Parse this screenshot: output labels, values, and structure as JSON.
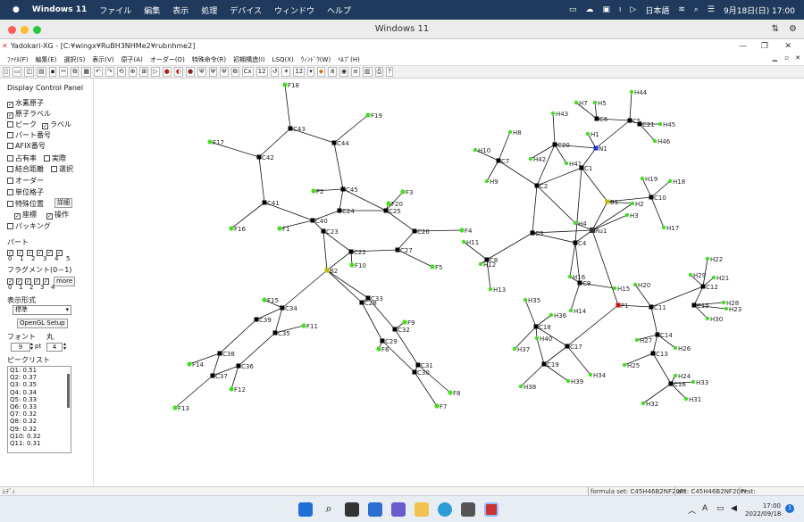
{
  "mac_menu": {
    "app": "Windows 11",
    "items": [
      "ファイル",
      "編集",
      "表示",
      "処理",
      "デバイス",
      "ウィンドウ",
      "ヘルプ"
    ],
    "ime": "日本語",
    "date": "9月18日(日) 17:00"
  },
  "vm_title": "Windows 11",
  "window": {
    "title": "Yadokari-XG - [C:¥wingx¥RuBH3NHMe2¥rubnhme2]"
  },
  "menu": [
    "ﾌｧｲﾙ(F)",
    "編集(E)",
    "選択(S)",
    "表示(V)",
    "原子(A)",
    "オーダー(O)",
    "特殊命令(R)",
    "初期構造(I)",
    "LSQ(X)",
    "ｳｨﾝﾄﾞｳ(W)",
    "ﾍﾙﾌﾟ(H)"
  ],
  "toolbar": {
    "cx": "Cx",
    "num": "12",
    "font_size": "12"
  },
  "panel": {
    "title": "Display Control Panel",
    "checks": [
      {
        "label": "水素原子",
        "checked": true
      },
      {
        "label": "原子ラベル",
        "checked": true
      },
      {
        "label": "ピーク",
        "checked": false
      },
      {
        "label": "ラベル",
        "checked": true
      },
      {
        "label": "パート番号",
        "checked": false
      },
      {
        "label": "AFIX番号",
        "checked": false
      },
      {
        "label": "占有率",
        "checked": false
      },
      {
        "label": "実際",
        "checked": false
      },
      {
        "label": "結合距離",
        "checked": false
      },
      {
        "label": "選択",
        "checked": false
      },
      {
        "label": "オーダー",
        "checked": false
      },
      {
        "label": "単位格子",
        "checked": false
      },
      {
        "label": "特殊位置",
        "checked": false
      },
      {
        "label": "座標",
        "checked": true
      },
      {
        "label": "操作",
        "checked": true
      },
      {
        "label": "パッキング",
        "checked": false
      }
    ],
    "detail_btn": "詳細",
    "part_label": "パート",
    "part_nums": [
      "0",
      "1",
      "2",
      "3",
      "4",
      "5"
    ],
    "frag_label": "フラグメント(0－1)",
    "frag_nums": [
      "0",
      "1",
      "2",
      "3",
      "4"
    ],
    "more_btn": "more",
    "display_label": "表示形式",
    "display_value": "標準",
    "opengl_btn": "OpenGL Setup",
    "font_label": "フォント",
    "font_value": "9",
    "font_unit": "pt",
    "circle_label": "丸",
    "circle_value": "4",
    "peak_label": "ピークリスト",
    "peaks": [
      "Q1:  0.51",
      "Q2:  0.37",
      "Q3:  0.35",
      "Q4:  0.34",
      "Q5:  0.33",
      "Q6:  0.33",
      "Q7:  0.32",
      "Q8:  0.32",
      "Q9:  0.32",
      "Q10:  0.32",
      "Q11:  0.31"
    ]
  },
  "status": {
    "left": "ﾚﾃﾞｨ",
    "formula": "formula set: C45H46B2NF20PI",
    "act": "act: C45H46B2NF20PI",
    "rest": "rest:"
  },
  "taskbar": {
    "time": "17:00",
    "date": "2022/09/18",
    "notif": "1"
  },
  "colors": {
    "h": "#44dd22",
    "f": "#44dd22",
    "c": "#000000",
    "n": "#2233cc",
    "p": "#cc1111",
    "b": "#bbbb00",
    "ru": "#333333"
  },
  "molecule": {
    "atoms": [
      [
        "F18",
        "f",
        212,
        7
      ],
      [
        "C43",
        "c",
        218,
        56
      ],
      [
        "F19",
        "f",
        305,
        41
      ],
      [
        "C44",
        "c",
        267,
        72
      ],
      [
        "F17",
        "f",
        128,
        71
      ],
      [
        "C42",
        "c",
        183,
        88
      ],
      [
        "F2",
        "f",
        244,
        126
      ],
      [
        "C45",
        "c",
        277,
        124
      ],
      [
        "F3",
        "f",
        344,
        127
      ],
      [
        "F20",
        "f",
        328,
        140
      ],
      [
        "C41",
        "c",
        189,
        139
      ],
      [
        "C24",
        "c",
        273,
        148
      ],
      [
        "C25",
        "c",
        325,
        148
      ],
      [
        "C40",
        "c",
        243,
        159
      ],
      [
        "F16",
        "f",
        152,
        168
      ],
      [
        "F1",
        "f",
        206,
        168
      ],
      [
        "C23",
        "c",
        255,
        171
      ],
      [
        "C26",
        "c",
        357,
        171
      ],
      [
        "F4",
        "f",
        410,
        170
      ],
      [
        "C22",
        "c",
        286,
        194
      ],
      [
        "C27",
        "c",
        338,
        192
      ],
      [
        "F10",
        "f",
        287,
        209
      ],
      [
        "F5",
        "f",
        377,
        211
      ],
      [
        "B2",
        "b",
        259,
        215
      ],
      [
        "C33",
        "c",
        305,
        246
      ],
      [
        "C28",
        "c",
        298,
        251
      ],
      [
        "F15",
        "f",
        189,
        248
      ],
      [
        "C34",
        "c",
        209,
        257
      ],
      [
        "C39",
        "c",
        180,
        270
      ],
      [
        "F9",
        "f",
        346,
        273
      ],
      [
        "F11",
        "f",
        233,
        277
      ],
      [
        "C35",
        "c",
        201,
        285
      ],
      [
        "C32",
        "c",
        335,
        281
      ],
      [
        "C29",
        "c",
        321,
        294
      ],
      [
        "F6",
        "f",
        317,
        303
      ],
      [
        "C38",
        "c",
        139,
        308
      ],
      [
        "F14",
        "f",
        105,
        320
      ],
      [
        "C36",
        "c",
        160,
        322
      ],
      [
        "C31",
        "c",
        361,
        321
      ],
      [
        "C30",
        "c",
        357,
        329
      ],
      [
        "C37",
        "c",
        131,
        333
      ],
      [
        "F12",
        "f",
        152,
        348
      ],
      [
        "F8",
        "f",
        397,
        352
      ],
      [
        "F13",
        "f",
        89,
        369
      ],
      [
        "F7",
        "f",
        382,
        367
      ],
      [
        "H7",
        "h",
        538,
        27
      ],
      [
        "H5",
        "h",
        559,
        27
      ],
      [
        "H44",
        "h",
        600,
        15
      ],
      [
        "H43",
        "h",
        512,
        39
      ],
      [
        "C6",
        "c",
        561,
        45
      ],
      [
        "C5",
        "c",
        598,
        47
      ],
      [
        "C21",
        "c",
        609,
        51
      ],
      [
        "H45",
        "h",
        632,
        51
      ],
      [
        "H8",
        "h",
        464,
        60
      ],
      [
        "H1",
        "h",
        551,
        62
      ],
      [
        "C20",
        "c",
        514,
        74
      ],
      [
        "N1",
        "n",
        560,
        78
      ],
      [
        "H46",
        "h",
        626,
        70
      ],
      [
        "H10",
        "h",
        425,
        80
      ],
      [
        "C7",
        "c",
        451,
        92
      ],
      [
        "H42",
        "h",
        487,
        90
      ],
      [
        "H41",
        "h",
        527,
        95
      ],
      [
        "C1",
        "c",
        544,
        100
      ],
      [
        "H9",
        "h",
        438,
        115
      ],
      [
        "C2",
        "c",
        494,
        120
      ],
      [
        "H19",
        "h",
        612,
        112
      ],
      [
        "H18",
        "h",
        643,
        115
      ],
      [
        "C10",
        "c",
        622,
        133
      ],
      [
        "B1",
        "b",
        573,
        138
      ],
      [
        "H2",
        "h",
        601,
        140
      ],
      [
        "H3",
        "h",
        595,
        153
      ],
      [
        "H4",
        "h",
        537,
        162
      ],
      [
        "Ru1",
        "ru",
        556,
        170
      ],
      [
        "H17",
        "h",
        636,
        167
      ],
      [
        "C3",
        "c",
        489,
        173
      ],
      [
        "C4",
        "c",
        537,
        184
      ],
      [
        "H11",
        "h",
        412,
        183
      ],
      [
        "C8",
        "c",
        438,
        203
      ],
      [
        "H12",
        "h",
        431,
        208
      ],
      [
        "H22",
        "h",
        685,
        202
      ],
      [
        "H29",
        "h",
        666,
        220
      ],
      [
        "H21",
        "h",
        692,
        223
      ],
      [
        "H16",
        "h",
        531,
        222
      ],
      [
        "C9",
        "c",
        542,
        229
      ],
      [
        "H13",
        "h",
        442,
        236
      ],
      [
        "H15",
        "h",
        581,
        235
      ],
      [
        "H20",
        "h",
        604,
        231
      ],
      [
        "C12",
        "c",
        680,
        233
      ],
      [
        "H28",
        "h",
        703,
        251
      ],
      [
        "H35",
        "h",
        481,
        248
      ],
      [
        "P1",
        "p",
        585,
        254
      ],
      [
        "C11",
        "c",
        622,
        256
      ],
      [
        "C15",
        "c",
        670,
        254
      ],
      [
        "H23",
        "h",
        706,
        258
      ],
      [
        "H14",
        "h",
        532,
        260
      ],
      [
        "H36",
        "h",
        510,
        265
      ],
      [
        "C18",
        "c",
        493,
        278
      ],
      [
        "H30",
        "h",
        685,
        269
      ],
      [
        "H40",
        "h",
        494,
        291
      ],
      [
        "C14",
        "c",
        629,
        287
      ],
      [
        "H27",
        "h",
        606,
        293
      ],
      [
        "C17",
        "c",
        528,
        300
      ],
      [
        "H37",
        "h",
        469,
        303
      ],
      [
        "H26",
        "h",
        649,
        302
      ],
      [
        "C13",
        "c",
        624,
        308
      ],
      [
        "C19",
        "c",
        502,
        320
      ],
      [
        "H25",
        "h",
        592,
        321
      ],
      [
        "H34",
        "h",
        554,
        332
      ],
      [
        "H24",
        "h",
        649,
        333
      ],
      [
        "C16",
        "c",
        644,
        342
      ],
      [
        "H33",
        "h",
        669,
        340
      ],
      [
        "H39",
        "h",
        529,
        339
      ],
      [
        "H38",
        "h",
        476,
        345
      ],
      [
        "H31",
        "h",
        661,
        359
      ],
      [
        "H32",
        "h",
        613,
        364
      ]
    ],
    "bonds": [
      [
        "F18",
        "C43"
      ],
      [
        "C43",
        "C42"
      ],
      [
        "C43",
        "C44"
      ],
      [
        "C44",
        "F19"
      ],
      [
        "C42",
        "F17"
      ],
      [
        "C42",
        "C41"
      ],
      [
        "C44",
        "C45"
      ],
      [
        "C45",
        "F2"
      ],
      [
        "C45",
        "C24"
      ],
      [
        "C45",
        "C25"
      ],
      [
        "C41",
        "F16"
      ],
      [
        "C41",
        "C40"
      ],
      [
        "C40",
        "C24"
      ],
      [
        "C24",
        "C25"
      ],
      [
        "C25",
        "F3"
      ],
      [
        "C25",
        "F20"
      ],
      [
        "C25",
        "C26"
      ],
      [
        "C40",
        "F1"
      ],
      [
        "C40",
        "C23"
      ],
      [
        "C23",
        "C22"
      ],
      [
        "C23",
        "B2"
      ],
      [
        "C26",
        "F4"
      ],
      [
        "C26",
        "C27"
      ],
      [
        "C22",
        "C27"
      ],
      [
        "C27",
        "F5"
      ],
      [
        "C22",
        "F10"
      ],
      [
        "C22",
        "B2"
      ],
      [
        "B2",
        "C33"
      ],
      [
        "B2",
        "C28"
      ],
      [
        "B2",
        "C34"
      ],
      [
        "C28",
        "C33"
      ],
      [
        "C28",
        "C29"
      ],
      [
        "C33",
        "C32"
      ],
      [
        "C32",
        "F9"
      ],
      [
        "C32",
        "C31"
      ],
      [
        "C29",
        "F6"
      ],
      [
        "C29",
        "C30"
      ],
      [
        "C31",
        "C30"
      ],
      [
        "C31",
        "F8"
      ],
      [
        "C30",
        "F7"
      ],
      [
        "C34",
        "F15"
      ],
      [
        "C34",
        "C35"
      ],
      [
        "C34",
        "C39"
      ],
      [
        "C39",
        "C38"
      ],
      [
        "C35",
        "F11"
      ],
      [
        "C35",
        "C36"
      ],
      [
        "C38",
        "F14"
      ],
      [
        "C38",
        "C37"
      ],
      [
        "C36",
        "C37"
      ],
      [
        "C36",
        "F12"
      ],
      [
        "C37",
        "F13"
      ],
      [
        "C6",
        "H7"
      ],
      [
        "C6",
        "H5"
      ],
      [
        "C6",
        "C5"
      ],
      [
        "C5",
        "H44"
      ],
      [
        "C5",
        "C21"
      ],
      [
        "C21",
        "H45"
      ],
      [
        "C21",
        "H46"
      ],
      [
        "C5",
        "N1"
      ],
      [
        "N1",
        "H1"
      ],
      [
        "N1",
        "C20"
      ],
      [
        "N1",
        "C1"
      ],
      [
        "C20",
        "H43"
      ],
      [
        "C20",
        "H42"
      ],
      [
        "C20",
        "H41"
      ],
      [
        "C20",
        "C2"
      ],
      [
        "C7",
        "H8"
      ],
      [
        "C7",
        "H10"
      ],
      [
        "C7",
        "H9"
      ],
      [
        "C7",
        "C2"
      ],
      [
        "C1",
        "C2"
      ],
      [
        "C1",
        "C4"
      ],
      [
        "C1",
        "B1"
      ],
      [
        "C2",
        "C3"
      ],
      [
        "C2",
        "H4"
      ],
      [
        "C3",
        "C4"
      ],
      [
        "C3",
        "Ru1"
      ],
      [
        "C3",
        "C8"
      ],
      [
        "C4",
        "Ru1"
      ],
      [
        "C4",
        "H16"
      ],
      [
        "C4",
        "C9"
      ],
      [
        "Ru1",
        "B1"
      ],
      [
        "Ru1",
        "H2"
      ],
      [
        "Ru1",
        "H3"
      ],
      [
        "Ru1",
        "H4"
      ],
      [
        "Ru1",
        "P1"
      ],
      [
        "B1",
        "C10"
      ],
      [
        "C10",
        "H19"
      ],
      [
        "C10",
        "H18"
      ],
      [
        "C10",
        "H17"
      ],
      [
        "B1",
        "H2"
      ],
      [
        "C8",
        "H11"
      ],
      [
        "C8",
        "H12"
      ],
      [
        "C8",
        "H13"
      ],
      [
        "C9",
        "H14"
      ],
      [
        "C9",
        "H15"
      ],
      [
        "C9",
        "H16"
      ],
      [
        "P1",
        "C11"
      ],
      [
        "P1",
        "C17"
      ],
      [
        "C11",
        "H20"
      ],
      [
        "C11",
        "C12"
      ],
      [
        "C11",
        "C14"
      ],
      [
        "C12",
        "H22"
      ],
      [
        "C12",
        "H21"
      ],
      [
        "C12",
        "H29"
      ],
      [
        "C12",
        "C15"
      ],
      [
        "C15",
        "H28"
      ],
      [
        "C15",
        "H23"
      ],
      [
        "C15",
        "H30"
      ],
      [
        "C14",
        "H27"
      ],
      [
        "C14",
        "H26"
      ],
      [
        "C14",
        "C13"
      ],
      [
        "C13",
        "H25"
      ],
      [
        "C13",
        "C16"
      ],
      [
        "C16",
        "H24"
      ],
      [
        "C16",
        "H33"
      ],
      [
        "C16",
        "H31"
      ],
      [
        "C16",
        "H32"
      ],
      [
        "C17",
        "C18"
      ],
      [
        "C17",
        "C19"
      ],
      [
        "C17",
        "H34"
      ],
      [
        "C18",
        "H35"
      ],
      [
        "C18",
        "H36"
      ],
      [
        "C18",
        "H40"
      ],
      [
        "C18",
        "H37"
      ],
      [
        "C19",
        "H39"
      ],
      [
        "C19",
        "H38"
      ],
      [
        "C19",
        "H40"
      ]
    ]
  }
}
